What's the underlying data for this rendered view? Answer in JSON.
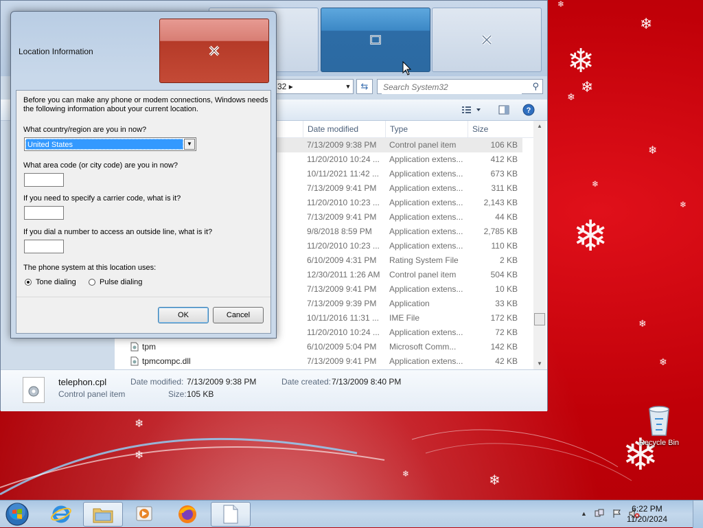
{
  "explorer": {
    "address_text": "32",
    "search_placeholder": "Search System32",
    "columns": {
      "date": "Date modified",
      "type": "Type",
      "size": "Size"
    },
    "rows": [
      {
        "name": "",
        "date": "7/13/2009 9:38 PM",
        "type": "Control panel item",
        "size": "106 KB",
        "selected": true
      },
      {
        "name": "",
        "date": "11/20/2010 10:24 ...",
        "type": "Application extens...",
        "size": "412 KB"
      },
      {
        "name": "",
        "date": "10/11/2021 11:42 ...",
        "type": "Application extens...",
        "size": "673 KB"
      },
      {
        "name": "",
        "date": "7/13/2009 9:41 PM",
        "type": "Application extens...",
        "size": "311 KB"
      },
      {
        "name": "",
        "date": "11/20/2010 10:23 ...",
        "type": "Application extens...",
        "size": "2,143 KB"
      },
      {
        "name": "",
        "date": "7/13/2009 9:41 PM",
        "type": "Application extens...",
        "size": "44 KB"
      },
      {
        "name": "",
        "date": "9/8/2018 8:59 PM",
        "type": "Application extens...",
        "size": "2,785 KB"
      },
      {
        "name": "",
        "date": "11/20/2010 10:23 ...",
        "type": "Application extens...",
        "size": "110 KB"
      },
      {
        "name": "",
        "date": "6/10/2009 4:31 PM",
        "type": "Rating System File",
        "size": "2 KB"
      },
      {
        "name": "",
        "date": "12/30/2011 1:26 AM",
        "type": "Control panel item",
        "size": "504 KB"
      },
      {
        "name": "",
        "date": "7/13/2009 9:41 PM",
        "type": "Application extens...",
        "size": "10 KB"
      },
      {
        "name": "",
        "date": "7/13/2009 9:39 PM",
        "type": "Application",
        "size": "33 KB"
      },
      {
        "name": "",
        "date": "10/11/2016 11:31 ...",
        "type": "IME File",
        "size": "172 KB"
      },
      {
        "name": "",
        "date": "11/20/2010 10:24 ...",
        "type": "Application extens...",
        "size": "72 KB"
      },
      {
        "name": "tpm",
        "date": "6/10/2009 5:04 PM",
        "type": "Microsoft Comm...",
        "size": "142 KB"
      },
      {
        "name": "tpmcompc.dll",
        "date": "7/13/2009 9:41 PM",
        "type": "Application extens...",
        "size": "42 KB"
      }
    ],
    "details": {
      "file_name": "telephon.cpl",
      "file_type": "Control panel item",
      "modified_label": "Date modified:",
      "modified_value": "7/13/2009 9:38 PM",
      "size_label": "Size:",
      "size_value": "105 KB",
      "created_label": "Date created:",
      "created_value": "7/13/2009 8:40 PM"
    }
  },
  "dialog": {
    "title": "Location Information",
    "intro": [
      "Before you can make any phone or modem connections, Windows needs",
      "the following information about your current location."
    ],
    "country_label": "What country/region are you in now?",
    "country_value": "United States",
    "area_label": "What area code (or city code) are you in now?",
    "area_value": "",
    "carrier_label": "If you need to specify a carrier code, what is it?",
    "carrier_value": "",
    "outside_label": "If you dial a number to access an outside line, what is it?",
    "outside_value": "",
    "phone_system_label": "The phone system at this location uses:",
    "tone_label": "Tone dialing",
    "pulse_label": "Pulse dialing",
    "tone_selected": true,
    "ok_label": "OK",
    "cancel_label": "Cancel"
  },
  "desktop": {
    "recycle_bin_label": "Recycle Bin"
  },
  "taskbar": {
    "time": "6:22 PM",
    "date": "11/20/2024",
    "items": [
      "start-orb",
      "internet-explorer",
      "file-explorer",
      "media-player",
      "firefox",
      "blank-window"
    ]
  },
  "colors": {
    "desktop_red": "#c00008",
    "selection_blue": "#3399ff",
    "close_red": "#c44a36",
    "maximize_blue": "#2d6ca6"
  }
}
